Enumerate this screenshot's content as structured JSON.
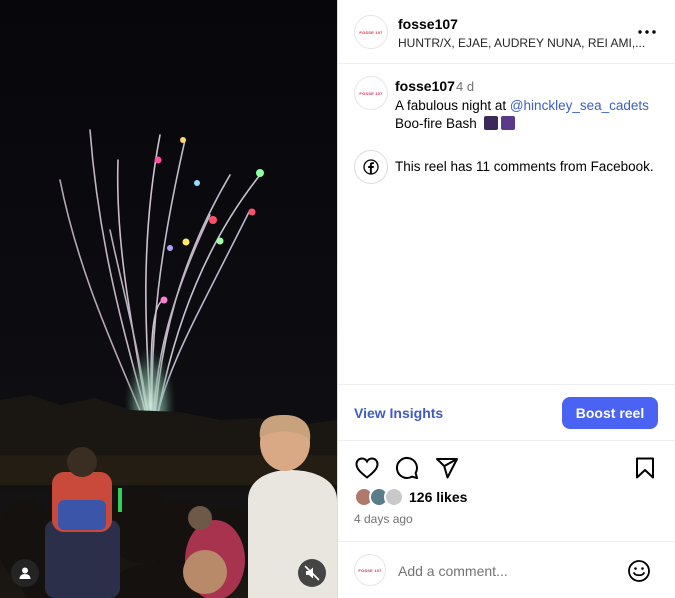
{
  "post": {
    "username": "fosse107",
    "audio": "HUNTR/X, EJAE, AUDREY NUNA, REI AMI,...",
    "avatar_text": "FOSSE 107"
  },
  "caption": {
    "username": "fosse107",
    "time": "4 d",
    "text_before": "A fabulous night at ",
    "mention": "@hinckley_sea_cadets",
    "text_after": "Boo-fire Bash"
  },
  "facebook_notice": "This reel has 11 comments from Facebook.",
  "insights_label": "View Insights",
  "boost_label": "Boost reel",
  "likes": "126 likes",
  "posted": "4 days ago",
  "comment": {
    "placeholder": "Add a comment..."
  },
  "icons": {
    "more": "more-icon",
    "facebook": "facebook-icon",
    "like": "heart-icon",
    "comment": "comment-icon",
    "share": "share-icon",
    "save": "bookmark-icon",
    "emoji": "smiley-icon",
    "user": "user-icon",
    "mute": "muted-speaker-icon"
  },
  "colors": {
    "accent": "#4b63f2",
    "link": "#3f5cc6",
    "mention": "#3b5fc4",
    "brand": "#d6304f"
  }
}
